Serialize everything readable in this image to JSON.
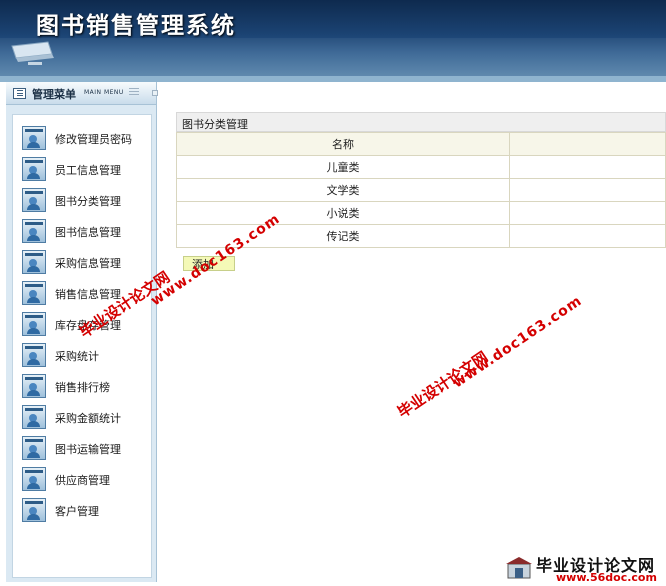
{
  "header": {
    "title": "图书销售管理系统"
  },
  "sidebar": {
    "title": "管理菜单",
    "subtitle": "MAIN MENU",
    "items": [
      {
        "label": "修改管理员密码"
      },
      {
        "label": "员工信息管理"
      },
      {
        "label": "图书分类管理"
      },
      {
        "label": "图书信息管理"
      },
      {
        "label": "采购信息管理"
      },
      {
        "label": "销售信息管理"
      },
      {
        "label": "库存盘存管理"
      },
      {
        "label": "采购统计"
      },
      {
        "label": "销售排行榜"
      },
      {
        "label": "采购金额统计"
      },
      {
        "label": "图书运输管理"
      },
      {
        "label": "供应商管理"
      },
      {
        "label": "客户管理"
      }
    ]
  },
  "main": {
    "panel_title": "图书分类管理",
    "table": {
      "columns": [
        "名称",
        ""
      ],
      "rows": [
        [
          "儿童类",
          ""
        ],
        [
          "文学类",
          ""
        ],
        [
          "小说类",
          ""
        ],
        [
          "传记类",
          ""
        ]
      ]
    },
    "add_label": "添加"
  },
  "watermarks": {
    "cn": "毕业设计论文网",
    "url": "www.doc163.com"
  },
  "logo": {
    "cn": "毕业设计论文网",
    "url": "www.56doc.com"
  },
  "colors": {
    "header": "#1b4373",
    "sidebar": "#dbe9f3",
    "watermark": "#d40000",
    "add_button": "#f4f9b7"
  }
}
